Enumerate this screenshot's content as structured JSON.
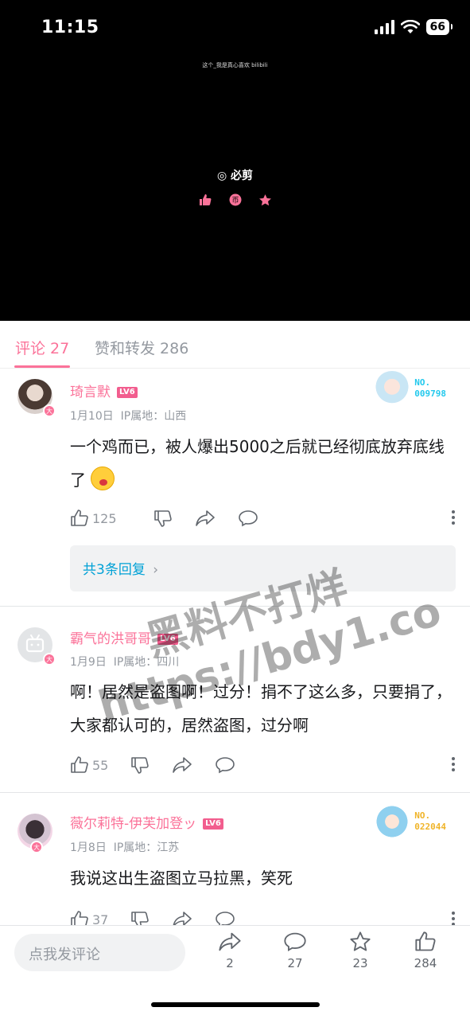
{
  "status_bar": {
    "time": "11:15",
    "battery": "66"
  },
  "video": {
    "caption": "这个_我是真心喜欢 bilibili",
    "editor_label": "必剪",
    "triple_icons": [
      "like-icon",
      "coin-icon",
      "favorite-icon"
    ]
  },
  "tabs": [
    {
      "label": "评论 27",
      "active": true
    },
    {
      "label": "赞和转发 286",
      "active": false
    }
  ],
  "comments": [
    {
      "username": "琦言默",
      "level": "LV6",
      "date": "1月10日",
      "ip": "IP属地：山西",
      "text": "一个鸡而已，被人爆出5000之后就已经彻底放弃底线了",
      "likes": "125",
      "reply_summary": "共3条回复",
      "fan_no": "NO.",
      "fan_number": "009798",
      "fan_color": "#23c9ed"
    },
    {
      "username": "霸气的洪哥哥",
      "level": "LV6",
      "date": "1月9日",
      "ip": "IP属地：四川",
      "text": "啊！居然是盗图啊！过分！捐不了这么多，只要捐了，大家都认可的，居然盗图，过分啊",
      "likes": "55"
    },
    {
      "username": "薇尔莉特-伊芙加登ッ",
      "level": "LV6",
      "date": "1月8日",
      "ip": "IP属地：江苏",
      "text": "我说这出生盗图立马拉黑，笑死",
      "likes": "37",
      "fan_no": "NO.",
      "fan_number": "022044",
      "fan_color": "#f0b429"
    }
  ],
  "watermark": {
    "line1": "黑料不打烊",
    "line2": "https://bdy1.co"
  },
  "bottom_bar": {
    "placeholder": "点我发评论",
    "share_count": "2",
    "comment_count": "27",
    "favorite_count": "23",
    "like_count": "284"
  },
  "colors": {
    "accent": "#fb7299",
    "link": "#00a1d6",
    "muted": "#9499a0"
  }
}
